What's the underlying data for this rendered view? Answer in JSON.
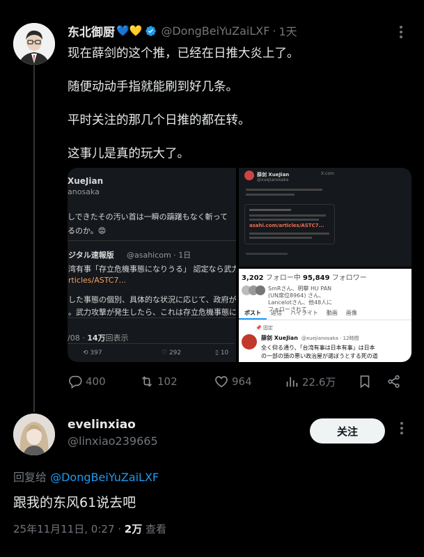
{
  "tweet": {
    "author_name": "东北御厨",
    "emoji": "💙💛",
    "handle": "@DongBeiYuZaiLXF",
    "time": "1天",
    "lines": [
      "现在薛剑的这个推，已经在日推大炎上了。",
      "随便动动手指就能刷到好几条。",
      "平时关注的那几个日推的都在转。",
      "这事儿是真的玩大了。"
    ],
    "stats": {
      "replies": "400",
      "retweets": "102",
      "likes": "964",
      "views": "22.6万"
    }
  },
  "media": {
    "left": {
      "name": "XueJian",
      "handle": "anosaka",
      "line1": "しできたその汚い首は一瞬の躊躇もなく斬って",
      "line2": "るのか。😡",
      "quoted_name": "ジタル速報版",
      "quoted_handle": "@asahicom · 1日",
      "q1": "湾有事「存立危機事態になりうる」 認定なら武力",
      "q2": "rticles/ASTC7...",
      "q3": "した事態の個別、具体的な状況に応じて、政府が",
      "q4": "。武力攻撃が発生したら、これは存立危機事態に",
      "date": "/08 · ",
      "views_bold": "14万",
      "views_suffix": "回表示",
      "rt": "397",
      "like": "292",
      "bm": "10"
    },
    "right_top": {
      "name": "薛剑 XueJian",
      "handle": "@xuejianosaka",
      "domain": "X.com",
      "link": "asahi.com/articles/ASTC7..."
    },
    "right_bottom": {
      "following_count": "3,202",
      "following_label": " フォロー中 ",
      "followers_count": "95,849",
      "followers_label": " フォロワー",
      "followed_by": "SmRさん、明攀 HU PAN (UN席位8964) さん、Lancelotさん、他48人にフォローされて...",
      "tabs": [
        "ポスト",
        "返信",
        "ハイライト",
        "動画",
        "画像"
      ],
      "pinned": "固定",
      "name": "薛剑 XueJian",
      "handle": "@xuejianosaka · 12時間",
      "t1": "全く仰る通り、「台湾有事は日本有事」は日本",
      "t2": "の一部の頭の悪い政治屋が選ぼうとする死の道"
    }
  },
  "reply": {
    "author_name": "evelinxiao",
    "handle": "@linxiao239665",
    "follow_label": "关注",
    "reply_prefix": "回复给 ",
    "reply_mention": "@DongBeiYuZaiLXF",
    "text": "跟我的东风61说去吧",
    "date": "25年11月11日, 0:27 · ",
    "views_count": "2万",
    "views_label": " 查看"
  },
  "colors": {
    "background": "#000000",
    "text": "#e7e9ea",
    "muted": "#71767b",
    "accent": "#1d9bf0",
    "verified": "#1d9bf0",
    "follow_button": "#eff3f4"
  },
  "icons": [
    "verified-icon",
    "more-icon",
    "reply-icon",
    "retweet-icon",
    "like-icon",
    "views-icon",
    "bookmark-icon",
    "share-icon"
  ]
}
